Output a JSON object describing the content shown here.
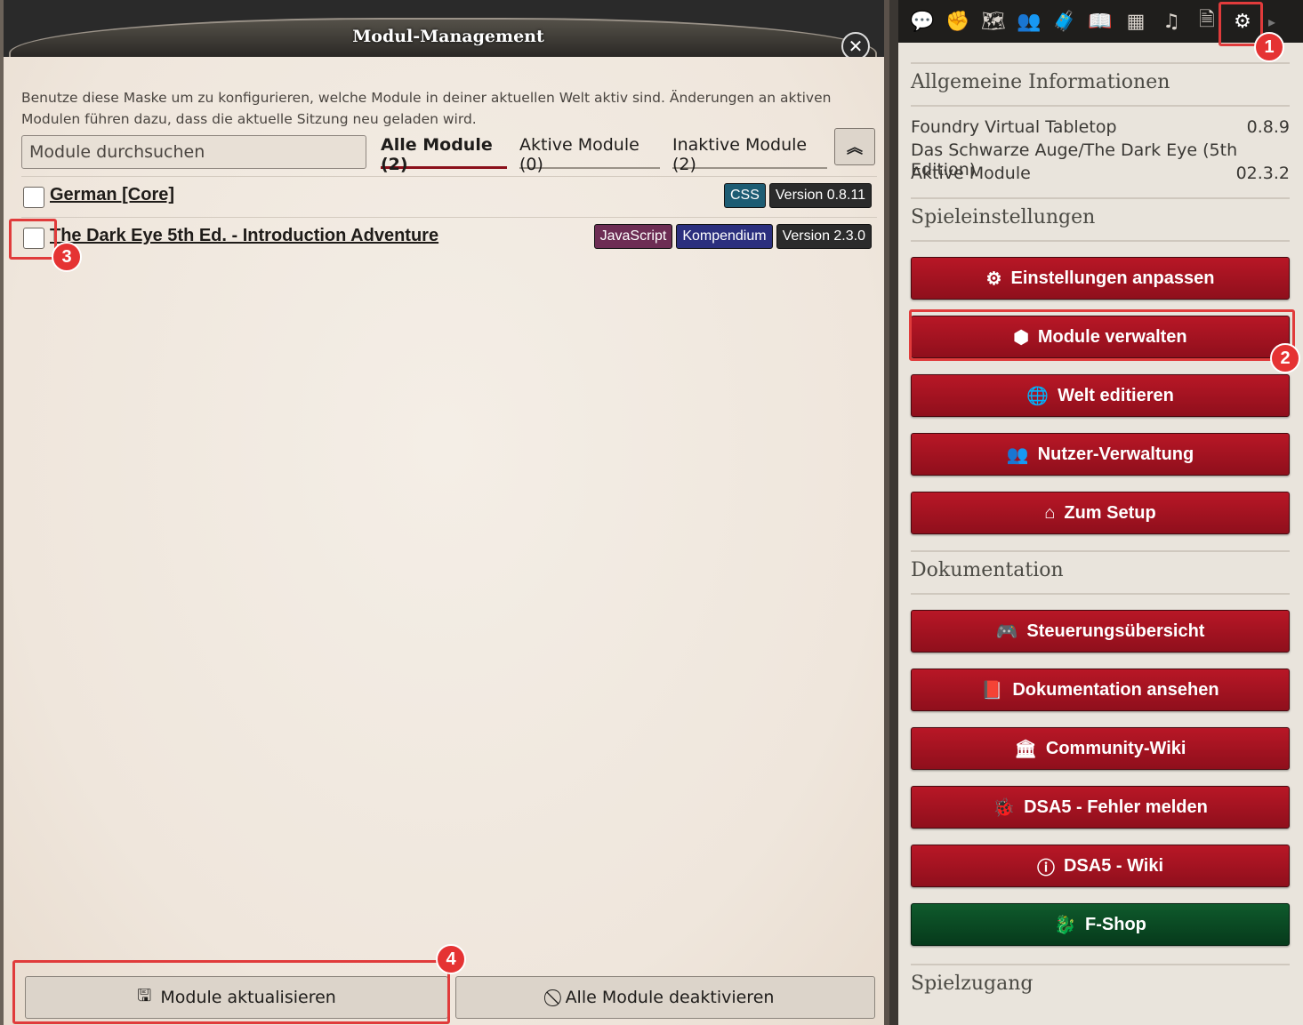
{
  "dialog": {
    "title": "Modul-Management",
    "close_icon": "close-icon",
    "intro_line1": "Benutze diese Maske um zu konfigurieren, welche Module in deiner aktuellen Welt aktiv sind. Änderungen an aktiven",
    "intro_line2": "Modulen führen dazu, dass die aktuelle Sitzung neu geladen wird.",
    "search_placeholder": "Module durchsuchen",
    "tabs": [
      {
        "label": "Alle Module (2)",
        "active": true
      },
      {
        "label": "Aktive Module (0)",
        "active": false
      },
      {
        "label": "Inaktive Module (2)",
        "active": false
      }
    ],
    "modules": [
      {
        "title": "German [Core]",
        "checked": false,
        "badges": [
          {
            "label": "CSS",
            "color": "#1d5c73"
          },
          {
            "label": "Version 0.8.11",
            "color": "#2b2b2b"
          }
        ]
      },
      {
        "title": "The Dark Eye 5th Ed. - Introduction Adventure",
        "checked": false,
        "badges": [
          {
            "label": "JavaScript",
            "color": "#6d2d54"
          },
          {
            "label": "Kompendium",
            "color": "#2b2f7e"
          },
          {
            "label": "Version 2.3.0",
            "color": "#2b2b2b"
          }
        ]
      }
    ],
    "footer": {
      "update_label": "Module aktualisieren",
      "deactivate_label": "Alle Module deaktivieren"
    }
  },
  "sidebar": {
    "tabs": [
      "chat-icon",
      "combat-icon",
      "scenes-icon",
      "actors-icon",
      "items-icon",
      "journal-icon",
      "tables-icon",
      "playlists-icon",
      "compendium-icon",
      "settings-icon"
    ],
    "general_heading": "Allgemeine Informationen",
    "info": [
      {
        "label": "Foundry Virtual Tabletop",
        "value": "0.8.9"
      },
      {
        "label": "Das Schwarze Auge/The Dark Eye (5th Edition)",
        "value": ""
      },
      {
        "label": "Aktive Module",
        "value": "02.3.2"
      }
    ],
    "game_settings_heading": "Spieleinstellungen",
    "game_buttons": [
      {
        "label": "Einstellungen anpassen",
        "icon": "cogs-icon"
      },
      {
        "label": "Module verwalten",
        "icon": "cube-icon"
      },
      {
        "label": "Welt editieren",
        "icon": "globe-icon"
      },
      {
        "label": "Nutzer-Verwaltung",
        "icon": "users-icon"
      },
      {
        "label": "Zum Setup",
        "icon": "home-icon"
      }
    ],
    "docs_heading": "Dokumentation",
    "doc_buttons": [
      {
        "label": "Steuerungsübersicht",
        "icon": "gamepad-icon"
      },
      {
        "label": "Dokumentation ansehen",
        "icon": "book-icon"
      },
      {
        "label": "Community-Wiki",
        "icon": "landmark-icon"
      },
      {
        "label": "DSA5 - Fehler melden",
        "icon": "bug-icon"
      },
      {
        "label": "DSA5 - Wiki",
        "icon": "info-icon"
      },
      {
        "label": "F-Shop",
        "icon": "shop-icon"
      }
    ],
    "access_heading": "Spielzugang"
  },
  "annotations": [
    "1",
    "2",
    "3",
    "4"
  ]
}
